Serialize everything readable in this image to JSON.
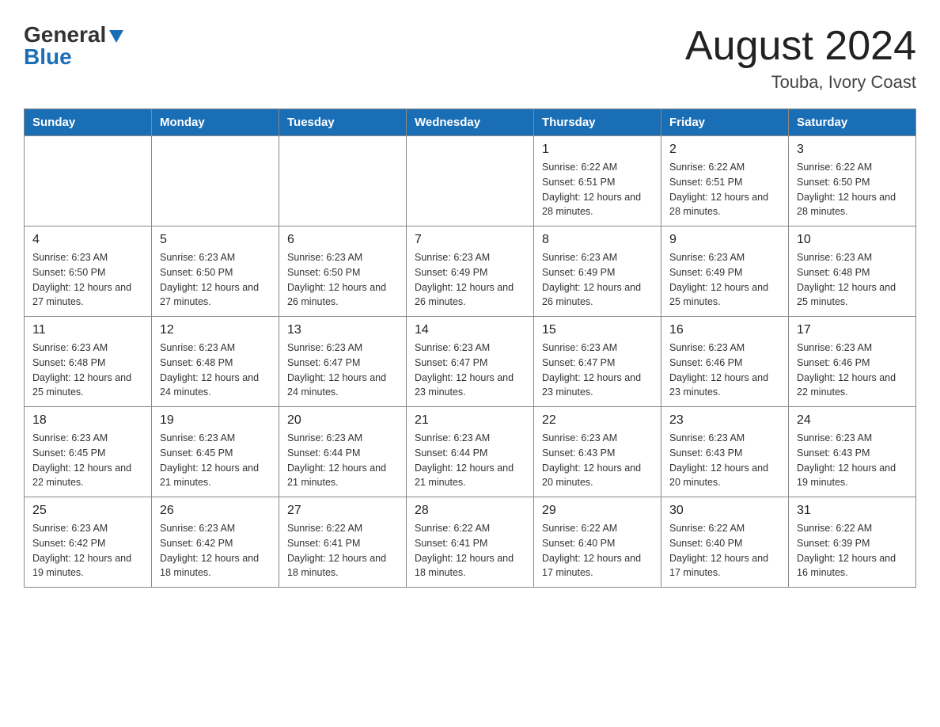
{
  "logo": {
    "general": "General",
    "blue": "Blue"
  },
  "header": {
    "month": "August 2024",
    "location": "Touba, Ivory Coast"
  },
  "weekdays": [
    "Sunday",
    "Monday",
    "Tuesday",
    "Wednesday",
    "Thursday",
    "Friday",
    "Saturday"
  ],
  "weeks": [
    [
      {
        "day": "",
        "info": ""
      },
      {
        "day": "",
        "info": ""
      },
      {
        "day": "",
        "info": ""
      },
      {
        "day": "",
        "info": ""
      },
      {
        "day": "1",
        "info": "Sunrise: 6:22 AM\nSunset: 6:51 PM\nDaylight: 12 hours and 28 minutes."
      },
      {
        "day": "2",
        "info": "Sunrise: 6:22 AM\nSunset: 6:51 PM\nDaylight: 12 hours and 28 minutes."
      },
      {
        "day": "3",
        "info": "Sunrise: 6:22 AM\nSunset: 6:50 PM\nDaylight: 12 hours and 28 minutes."
      }
    ],
    [
      {
        "day": "4",
        "info": "Sunrise: 6:23 AM\nSunset: 6:50 PM\nDaylight: 12 hours and 27 minutes."
      },
      {
        "day": "5",
        "info": "Sunrise: 6:23 AM\nSunset: 6:50 PM\nDaylight: 12 hours and 27 minutes."
      },
      {
        "day": "6",
        "info": "Sunrise: 6:23 AM\nSunset: 6:50 PM\nDaylight: 12 hours and 26 minutes."
      },
      {
        "day": "7",
        "info": "Sunrise: 6:23 AM\nSunset: 6:49 PM\nDaylight: 12 hours and 26 minutes."
      },
      {
        "day": "8",
        "info": "Sunrise: 6:23 AM\nSunset: 6:49 PM\nDaylight: 12 hours and 26 minutes."
      },
      {
        "day": "9",
        "info": "Sunrise: 6:23 AM\nSunset: 6:49 PM\nDaylight: 12 hours and 25 minutes."
      },
      {
        "day": "10",
        "info": "Sunrise: 6:23 AM\nSunset: 6:48 PM\nDaylight: 12 hours and 25 minutes."
      }
    ],
    [
      {
        "day": "11",
        "info": "Sunrise: 6:23 AM\nSunset: 6:48 PM\nDaylight: 12 hours and 25 minutes."
      },
      {
        "day": "12",
        "info": "Sunrise: 6:23 AM\nSunset: 6:48 PM\nDaylight: 12 hours and 24 minutes."
      },
      {
        "day": "13",
        "info": "Sunrise: 6:23 AM\nSunset: 6:47 PM\nDaylight: 12 hours and 24 minutes."
      },
      {
        "day": "14",
        "info": "Sunrise: 6:23 AM\nSunset: 6:47 PM\nDaylight: 12 hours and 23 minutes."
      },
      {
        "day": "15",
        "info": "Sunrise: 6:23 AM\nSunset: 6:47 PM\nDaylight: 12 hours and 23 minutes."
      },
      {
        "day": "16",
        "info": "Sunrise: 6:23 AM\nSunset: 6:46 PM\nDaylight: 12 hours and 23 minutes."
      },
      {
        "day": "17",
        "info": "Sunrise: 6:23 AM\nSunset: 6:46 PM\nDaylight: 12 hours and 22 minutes."
      }
    ],
    [
      {
        "day": "18",
        "info": "Sunrise: 6:23 AM\nSunset: 6:45 PM\nDaylight: 12 hours and 22 minutes."
      },
      {
        "day": "19",
        "info": "Sunrise: 6:23 AM\nSunset: 6:45 PM\nDaylight: 12 hours and 21 minutes."
      },
      {
        "day": "20",
        "info": "Sunrise: 6:23 AM\nSunset: 6:44 PM\nDaylight: 12 hours and 21 minutes."
      },
      {
        "day": "21",
        "info": "Sunrise: 6:23 AM\nSunset: 6:44 PM\nDaylight: 12 hours and 21 minutes."
      },
      {
        "day": "22",
        "info": "Sunrise: 6:23 AM\nSunset: 6:43 PM\nDaylight: 12 hours and 20 minutes."
      },
      {
        "day": "23",
        "info": "Sunrise: 6:23 AM\nSunset: 6:43 PM\nDaylight: 12 hours and 20 minutes."
      },
      {
        "day": "24",
        "info": "Sunrise: 6:23 AM\nSunset: 6:43 PM\nDaylight: 12 hours and 19 minutes."
      }
    ],
    [
      {
        "day": "25",
        "info": "Sunrise: 6:23 AM\nSunset: 6:42 PM\nDaylight: 12 hours and 19 minutes."
      },
      {
        "day": "26",
        "info": "Sunrise: 6:23 AM\nSunset: 6:42 PM\nDaylight: 12 hours and 18 minutes."
      },
      {
        "day": "27",
        "info": "Sunrise: 6:22 AM\nSunset: 6:41 PM\nDaylight: 12 hours and 18 minutes."
      },
      {
        "day": "28",
        "info": "Sunrise: 6:22 AM\nSunset: 6:41 PM\nDaylight: 12 hours and 18 minutes."
      },
      {
        "day": "29",
        "info": "Sunrise: 6:22 AM\nSunset: 6:40 PM\nDaylight: 12 hours and 17 minutes."
      },
      {
        "day": "30",
        "info": "Sunrise: 6:22 AM\nSunset: 6:40 PM\nDaylight: 12 hours and 17 minutes."
      },
      {
        "day": "31",
        "info": "Sunrise: 6:22 AM\nSunset: 6:39 PM\nDaylight: 12 hours and 16 minutes."
      }
    ]
  ]
}
